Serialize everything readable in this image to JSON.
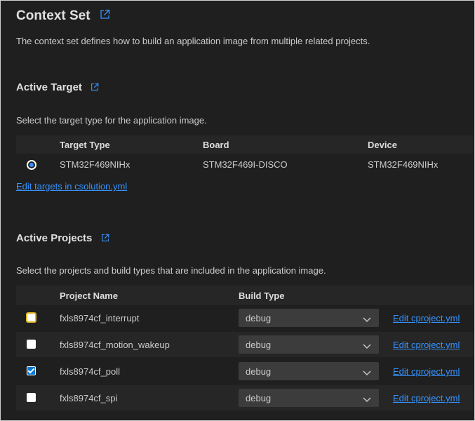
{
  "header": {
    "title": "Context Set",
    "description": "The context set defines how to build an application image from multiple related projects."
  },
  "active_target": {
    "title": "Active Target",
    "description": "Select the target type for the application image.",
    "columns": [
      "Target Type",
      "Board",
      "Device"
    ],
    "row": {
      "target_type": "STM32F469NIHx",
      "board": "STM32F469I-DISCO",
      "device": "STM32F469NIHx",
      "selected": true
    },
    "edit_link": "Edit targets in csolution.yml"
  },
  "active_projects": {
    "title": "Active Projects",
    "description": "Select the projects and build types that are included in the application image.",
    "columns": [
      "Project Name",
      "Build Type"
    ],
    "rows": [
      {
        "name": "fxls8974cf_interrupt",
        "build_type": "debug",
        "checked": false,
        "edit_link": "Edit cproject.yml"
      },
      {
        "name": "fxls8974cf_motion_wakeup",
        "build_type": "debug",
        "checked": false,
        "edit_link": "Edit cproject.yml"
      },
      {
        "name": "fxls8974cf_poll",
        "build_type": "debug",
        "checked": true,
        "edit_link": "Edit cproject.yml"
      },
      {
        "name": "fxls8974cf_spi",
        "build_type": "debug",
        "checked": false,
        "edit_link": "Edit cproject.yml"
      }
    ]
  },
  "colors": {
    "link": "#3794ff",
    "background": "#1f1f1f",
    "checkbox_checked": "#0078d4"
  },
  "icons": [
    "external-link-icon",
    "chevron-down-icon"
  ]
}
